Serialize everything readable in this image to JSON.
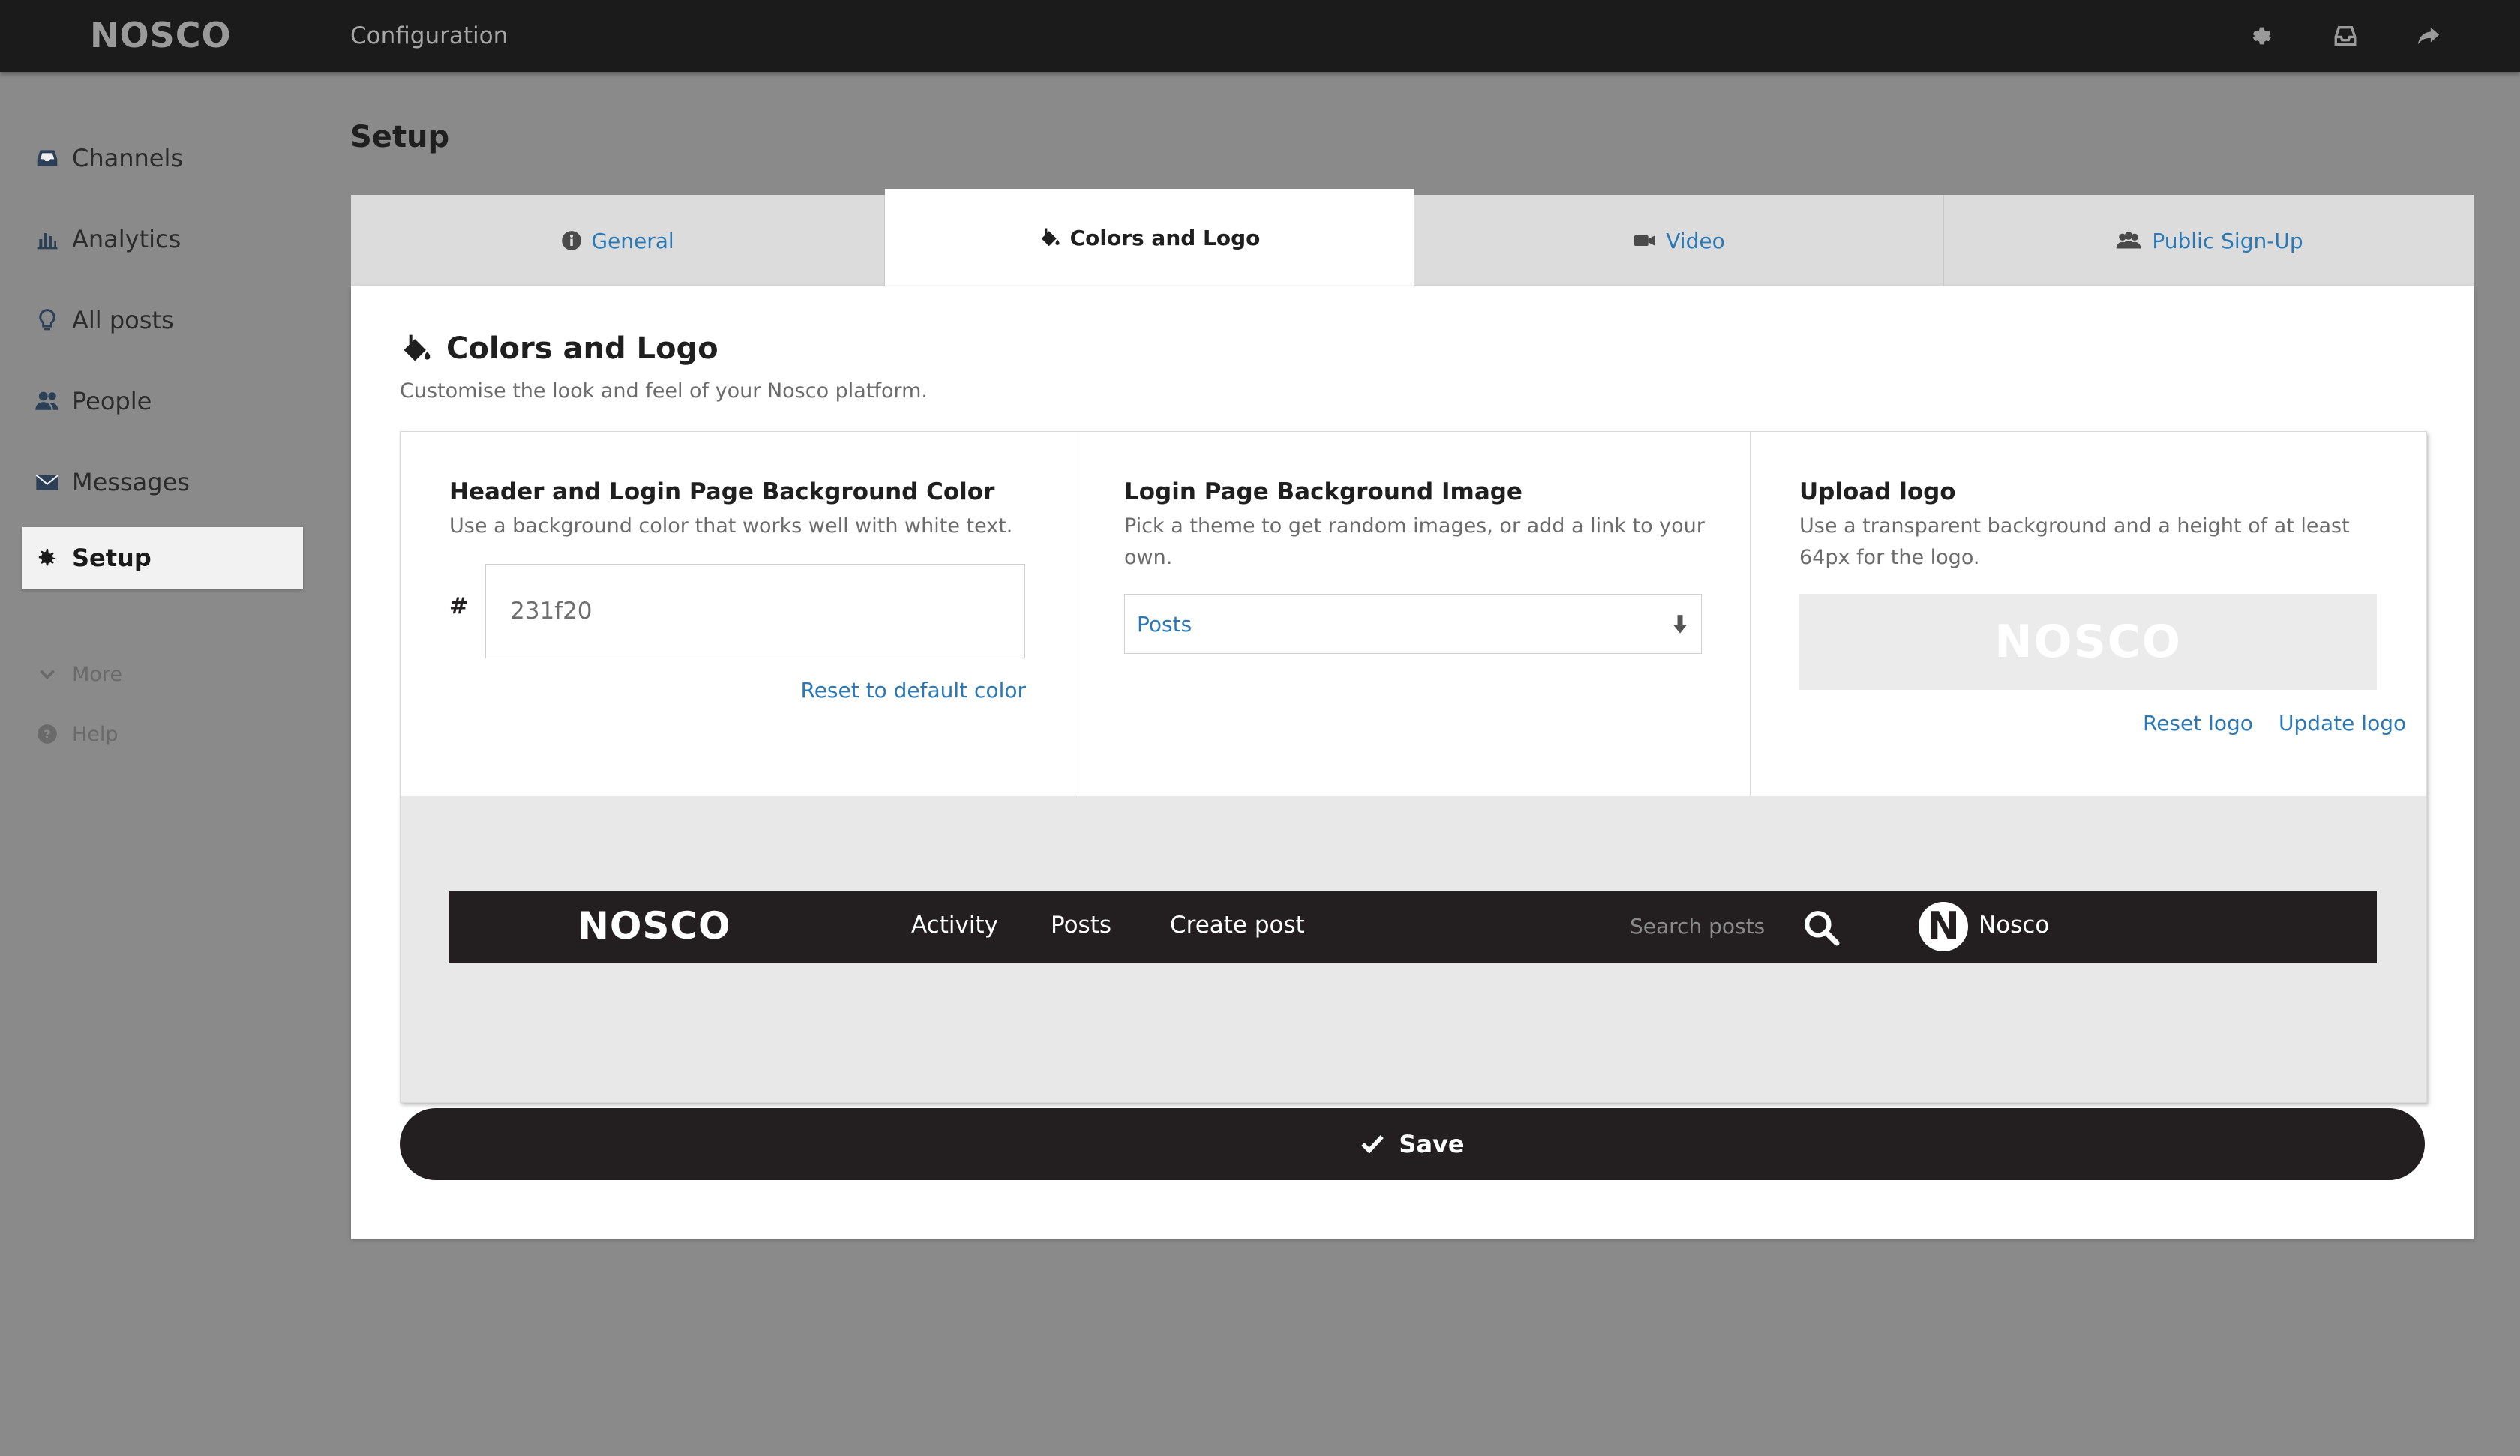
{
  "topbar": {
    "brand": "NOSCO",
    "breadcrumb": "Configuration"
  },
  "sidebar": {
    "items": [
      {
        "label": "Channels",
        "icon": "inbox-icon"
      },
      {
        "label": "Analytics",
        "icon": "bar-chart-icon"
      },
      {
        "label": "All posts",
        "icon": "lightbulb-icon"
      },
      {
        "label": "People",
        "icon": "people-icon"
      },
      {
        "label": "Messages",
        "icon": "envelope-icon"
      },
      {
        "label": "Setup",
        "icon": "gear-icon",
        "active": true
      }
    ],
    "more_label": "More",
    "help_label": "Help"
  },
  "page": {
    "title": "Setup"
  },
  "tabs": [
    {
      "label": "General",
      "icon": "info-icon"
    },
    {
      "label": "Colors and Logo",
      "icon": "paint-bucket-icon",
      "active": true
    },
    {
      "label": "Video",
      "icon": "video-camera-icon"
    },
    {
      "label": "Public Sign-Up",
      "icon": "people-icon"
    }
  ],
  "panel": {
    "title": "Colors and Logo",
    "subtitle": "Customise the look and feel of your Nosco platform.",
    "color_card": {
      "title": "Header and Login Page Background Color",
      "description": "Use a background color that works well with white text.",
      "hash": "#",
      "value": "231f20",
      "reset_label": "Reset to default color"
    },
    "image_card": {
      "title": "Login Page Background Image",
      "description": "Pick a theme to get random images, or add a link to your own.",
      "selected": "Posts"
    },
    "logo_card": {
      "title": "Upload logo",
      "description": "Use a transparent background and a height of at least 64px for the logo.",
      "logo_text": "NOSCO",
      "reset_label": "Reset logo",
      "update_label": "Update logo"
    },
    "preview": {
      "brand": "NOSCO",
      "nav": [
        "Activity",
        "Posts",
        "Create post"
      ],
      "search_placeholder": "Search posts",
      "avatar_letter": "N",
      "user": "Nosco"
    },
    "save_label": "Save"
  },
  "colors": {
    "header": "#231f20",
    "link": "#2a79b6",
    "background": "#8a8a8a"
  }
}
